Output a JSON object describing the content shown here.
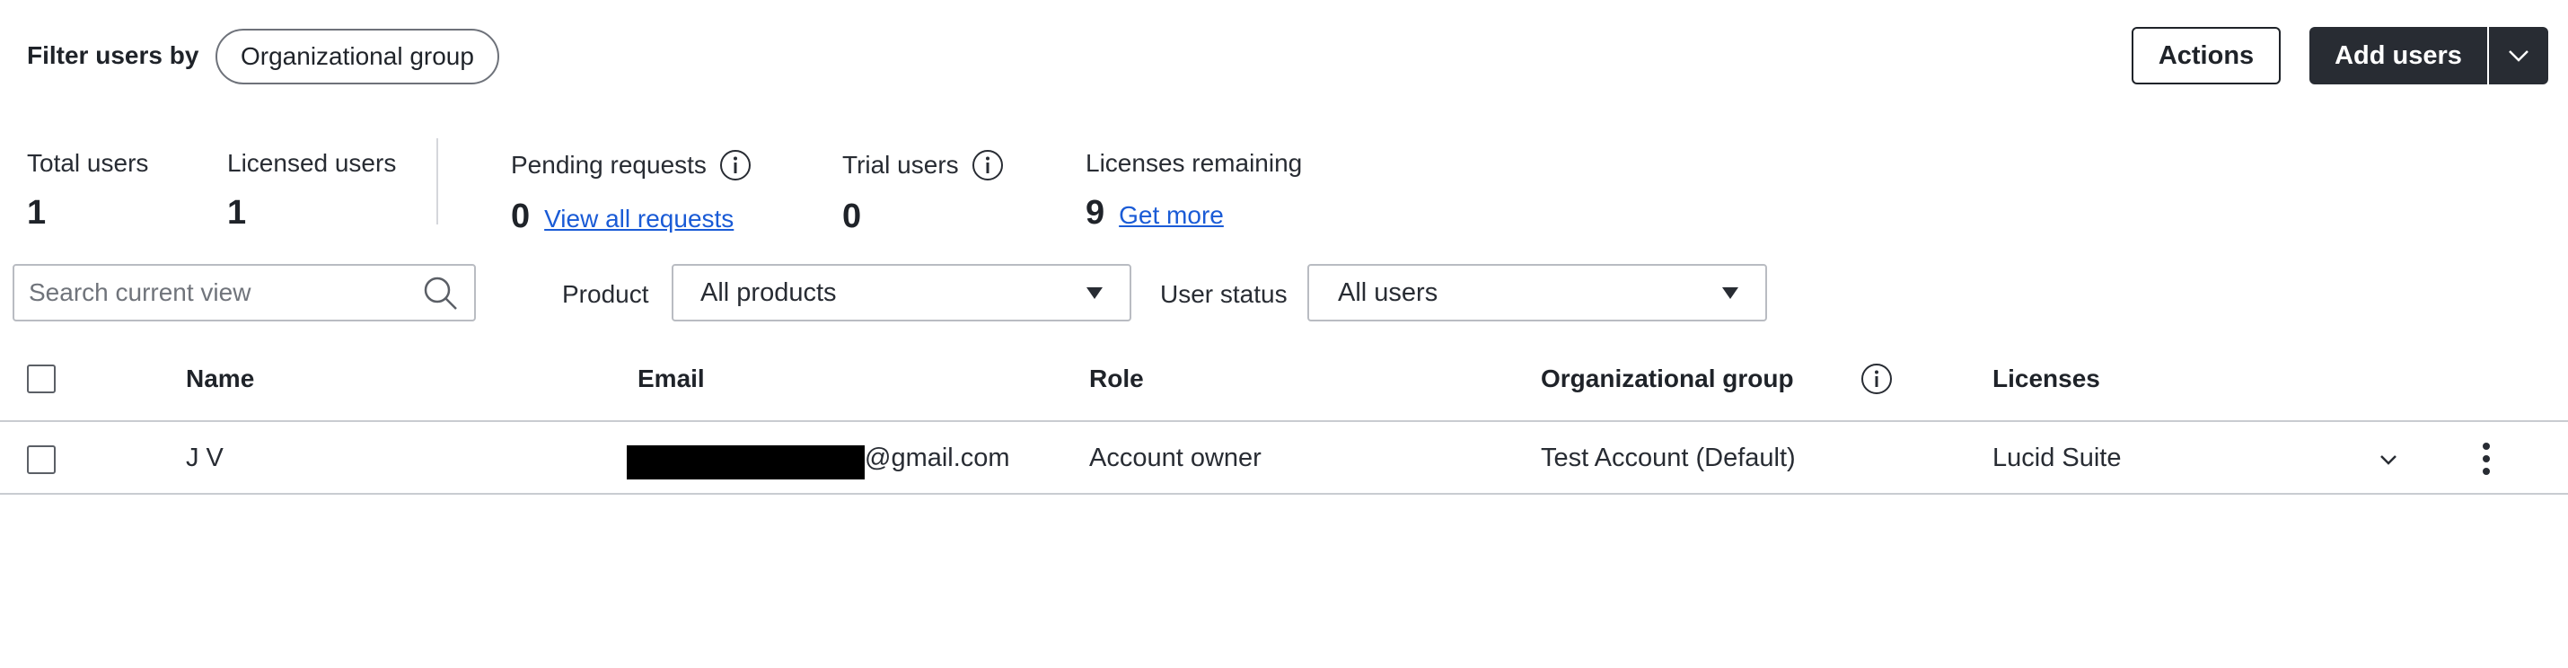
{
  "filter": {
    "label": "Filter users by",
    "chip_label": "Organizational group"
  },
  "header_actions": {
    "actions_label": "Actions",
    "add_users_label": "Add users",
    "add_users_menu_icon": "chevron-down-icon"
  },
  "stats": {
    "total_users": {
      "label": "Total users",
      "value": "1"
    },
    "licensed_users": {
      "label": "Licensed users",
      "value": "1"
    },
    "pending_requests": {
      "label": "Pending requests",
      "value": "0",
      "link": "View all requests",
      "icon": "info-icon"
    },
    "trial_users": {
      "label": "Trial users",
      "value": "0",
      "icon": "info-icon"
    },
    "licenses_remaining": {
      "label": "Licenses remaining",
      "value": "9",
      "link": "Get more"
    }
  },
  "filters": {
    "search_placeholder": "Search current view",
    "product_label": "Product",
    "product_value": "All products",
    "status_label": "User status",
    "status_value": "All users"
  },
  "table": {
    "columns": [
      "Name",
      "Email",
      "Role",
      "Organizational group",
      "Licenses"
    ],
    "org_group_info_icon": "info-icon",
    "rows": [
      {
        "name": "J V",
        "email": "@gmail.com",
        "role": "Account owner",
        "org_group": "Test Account (Default)",
        "licenses": "Lucid Suite"
      }
    ]
  },
  "colors": {
    "primary_button": "#282c33",
    "link": "#1a5bd6",
    "border": "#b9bcc2",
    "divider": "#c9ccd1"
  }
}
